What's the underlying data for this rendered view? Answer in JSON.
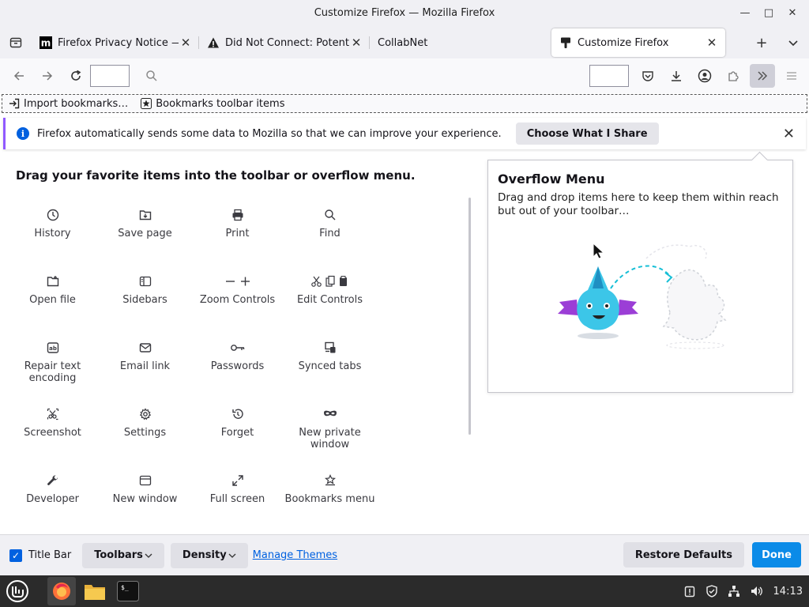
{
  "window": {
    "title": "Customize Firefox — Mozilla Firefox"
  },
  "tabs": [
    {
      "label": "Firefox Privacy Notice — Mo",
      "favicon": "mozilla-m-icon"
    },
    {
      "label": "Did Not Connect: Potential",
      "favicon": "warning-icon"
    },
    {
      "label": "CollabNet",
      "favicon": ""
    },
    {
      "label": "Customize Firefox",
      "favicon": "paintbrush-icon",
      "active": true
    }
  ],
  "bookmarks": {
    "import_label": "Import bookmarks…",
    "toolbar_items_label": "Bookmarks toolbar items"
  },
  "notification": {
    "message": "Firefox automatically sends some data to Mozilla so that we can improve your experience.",
    "button": "Choose What I Share"
  },
  "palette": {
    "title": "Drag your favorite items into the toolbar or overflow menu.",
    "items": [
      {
        "label": "History",
        "icon": "clock-icon"
      },
      {
        "label": "Save page",
        "icon": "save-folder-icon"
      },
      {
        "label": "Print",
        "icon": "printer-icon"
      },
      {
        "label": "Find",
        "icon": "magnifier-icon"
      },
      {
        "label": "Open file",
        "icon": "open-folder-icon"
      },
      {
        "label": "Sidebars",
        "icon": "sidebar-icon"
      },
      {
        "label": "Zoom Controls",
        "icon": "zoom-icon"
      },
      {
        "label": "Edit Controls",
        "icon": "edit-icon"
      },
      {
        "label": "Repair text encoding",
        "icon": "encoding-icon"
      },
      {
        "label": "Email link",
        "icon": "envelope-icon"
      },
      {
        "label": "Passwords",
        "icon": "key-icon"
      },
      {
        "label": "Synced tabs",
        "icon": "synced-tabs-icon"
      },
      {
        "label": "Screenshot",
        "icon": "scissors-icon"
      },
      {
        "label": "Settings",
        "icon": "gear-icon"
      },
      {
        "label": "Forget",
        "icon": "forget-icon"
      },
      {
        "label": "New private window",
        "icon": "mask-icon"
      },
      {
        "label": "Developer",
        "icon": "wrench-icon"
      },
      {
        "label": "New window",
        "icon": "window-icon"
      },
      {
        "label": "Full screen",
        "icon": "expand-icon"
      },
      {
        "label": "Bookmarks menu",
        "icon": "bookmark-star-icon"
      }
    ]
  },
  "overflow": {
    "title": "Overflow Menu",
    "description": "Drag and drop items here to keep them within reach but out of your toolbar…"
  },
  "footer": {
    "title_bar_label": "Title Bar",
    "title_bar_checked": true,
    "toolbars_label": "Toolbars",
    "density_label": "Density",
    "manage_themes": "Manage Themes",
    "restore_defaults": "Restore Defaults",
    "done": "Done"
  },
  "taskbar": {
    "clock": "14:13"
  },
  "colors": {
    "accent": "#0061e0",
    "done_button": "#0b8be8",
    "notif_border": "#9059ff"
  }
}
